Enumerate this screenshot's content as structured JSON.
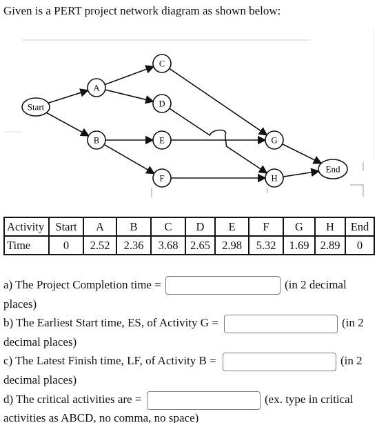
{
  "intro": "Given is a PERT project network diagram as shown below:",
  "diagram": {
    "nodes": [
      "Start",
      "A",
      "B",
      "C",
      "D",
      "E",
      "F",
      "G",
      "H",
      "End"
    ],
    "edges": [
      [
        "Start",
        "A"
      ],
      [
        "Start",
        "B"
      ],
      [
        "A",
        "C"
      ],
      [
        "A",
        "D"
      ],
      [
        "B",
        "E"
      ],
      [
        "B",
        "F"
      ],
      [
        "C",
        "G"
      ],
      [
        "D",
        "H"
      ],
      [
        "E",
        "G"
      ],
      [
        "F",
        "H"
      ],
      [
        "G",
        "End"
      ],
      [
        "H",
        "End"
      ]
    ]
  },
  "table": {
    "header": [
      "Activity",
      "Start",
      "A",
      "B",
      "C",
      "D",
      "E",
      "F",
      "G",
      "H",
      "End"
    ],
    "row": [
      "Time",
      "0",
      "2.52",
      "2.36",
      "3.68",
      "2.65",
      "2.98",
      "5.32",
      "1.69",
      "2.89",
      "0"
    ]
  },
  "questions": {
    "a": {
      "label": "a) The Project Completion time =",
      "suffix": "(in 2 decimal",
      "cont": "places)",
      "value": ""
    },
    "b": {
      "label": "b) The Earliest Start time, ES, of Activity G =",
      "suffix": "(in 2",
      "cont": "decimal places)",
      "value": ""
    },
    "c": {
      "label": "c) The Latest Finish time, LF, of Activity B =",
      "suffix": "(in 2",
      "cont": "decimal places)",
      "value": ""
    },
    "d": {
      "label": "d) The critical activities are =",
      "suffix": "(ex. type in critical",
      "cont": "activities as ABCD, no comma, no space)",
      "value": ""
    }
  }
}
